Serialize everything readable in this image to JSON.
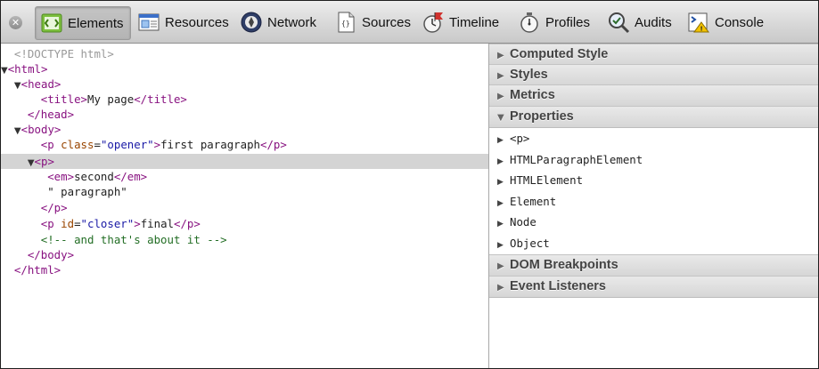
{
  "toolbar": {
    "close_icon": "close-circle-icon",
    "tabs": [
      {
        "label": "Elements",
        "icon": "elements-icon",
        "selected": true
      },
      {
        "label": "Resources",
        "icon": "resources-icon"
      },
      {
        "label": "Network",
        "icon": "network-icon"
      },
      {
        "label": "Sources",
        "icon": "sources-icon"
      },
      {
        "label": "Timeline",
        "icon": "timeline-icon"
      },
      {
        "label": "Profiles",
        "icon": "profiles-icon"
      },
      {
        "label": "Audits",
        "icon": "audits-icon"
      },
      {
        "label": "Console",
        "icon": "console-icon"
      }
    ]
  },
  "dom": {
    "doctype": "<!DOCTYPE html>",
    "html_open": "<html>",
    "head_open": "<head>",
    "title_open": "<title>",
    "title_text": "My page",
    "title_close": "</title>",
    "head_close": "</head>",
    "body_open": "<body>",
    "p1_open": "<p",
    "p1_attr": "class",
    "p1_val": "\"opener\"",
    "p1_gt": ">",
    "p1_text": "first paragraph",
    "p1_close": "</p>",
    "p2_open": "<p>",
    "em_open": "<em>",
    "em_text": "second",
    "em_close": "</em>",
    "text_node": "\" paragraph\"",
    "p2_close": "</p>",
    "p3_open": "<p",
    "p3_attr": "id",
    "p3_val": "\"closer\"",
    "p3_gt": ">",
    "p3_text": "final",
    "p3_close": "</p>",
    "comment": "<!-- and that's about it -->",
    "body_close": "</body>",
    "html_close": "</html>"
  },
  "sidebar": {
    "sections": [
      {
        "label": "Computed Style",
        "expanded": false
      },
      {
        "label": "Styles",
        "expanded": false
      },
      {
        "label": "Metrics",
        "expanded": false
      },
      {
        "label": "Properties",
        "expanded": true
      },
      {
        "label": "DOM Breakpoints",
        "expanded": false
      },
      {
        "label": "Event Listeners",
        "expanded": false
      }
    ],
    "properties": [
      "<p>",
      "HTMLParagraphElement",
      "HTMLElement",
      "Element",
      "Node",
      "Object"
    ]
  },
  "colors": {
    "tag": "#881280",
    "attribute": "#994500",
    "value": "#1a1aa6",
    "comment": "#236e25",
    "selection": "#d4d4d4"
  }
}
